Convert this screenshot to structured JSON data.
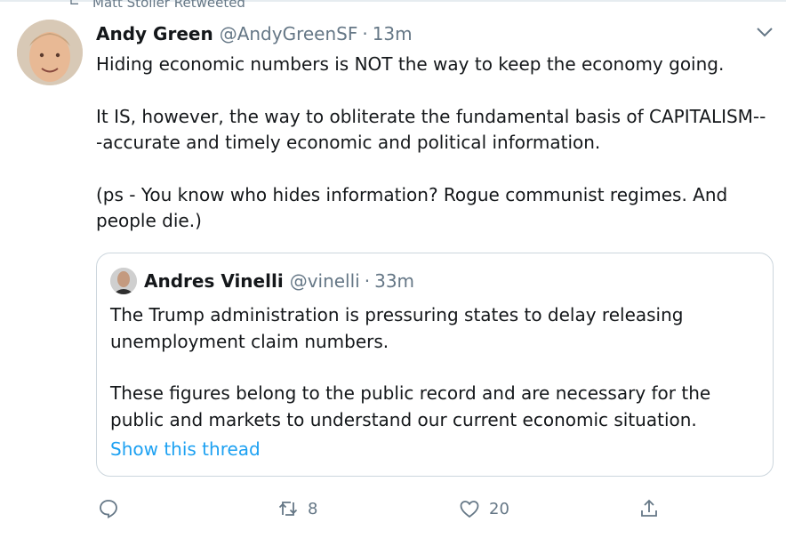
{
  "retweet_banner": {
    "text": "Matt Stoller Retweeted",
    "icon": "retweet-icon"
  },
  "tweet": {
    "author_name": "Andy Green",
    "author_handle": "@AndyGreenSF",
    "separator": "·",
    "time": "13m",
    "paragraphs": [
      "Hiding economic numbers is NOT the way to keep the economy going.",
      "It IS, however, the way to obliterate the fundamental basis of CAPITALISM---accurate and timely economic and political information.",
      "(ps - You know who hides information? Rogue communist regimes. And people die.)"
    ]
  },
  "quoted_tweet": {
    "author_name": "Andres Vinelli",
    "author_handle": "@vinelli",
    "separator": "·",
    "time": "33m",
    "paragraphs": [
      "The Trump administration is pressuring states to delay releasing unemployment claim numbers.",
      "These figures belong to the public record and are necessary for the public and markets to understand our current economic situation."
    ],
    "show_thread_label": "Show this thread"
  },
  "actions": {
    "reply_count": "",
    "retweet_count": "8",
    "like_count": "20"
  },
  "colors": {
    "accent": "#1da1f2",
    "secondary_text": "#657786",
    "border": "#ccd6dd"
  }
}
